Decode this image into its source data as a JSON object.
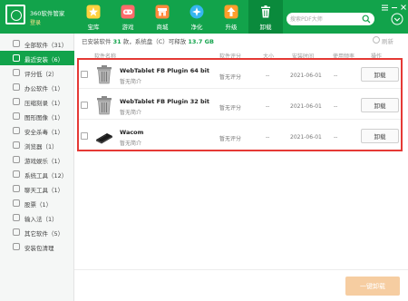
{
  "app": {
    "name": "360软件管家",
    "login": "登录"
  },
  "nav": {
    "tabs": [
      {
        "label": "宝库",
        "icon": "star-icon",
        "active": false
      },
      {
        "label": "游戏",
        "icon": "gamepad-icon",
        "active": false
      },
      {
        "label": "商城",
        "icon": "store-icon",
        "active": false
      },
      {
        "label": "净化",
        "icon": "clean-icon",
        "active": false
      },
      {
        "label": "升级",
        "icon": "upgrade-icon",
        "active": false
      },
      {
        "label": "卸载",
        "icon": "trash-icon",
        "active": true
      }
    ]
  },
  "search": {
    "placeholder": "搜索PDF大师"
  },
  "sidebar": {
    "items": [
      {
        "label": "全部软件（31）",
        "active": false
      },
      {
        "label": "最近安装（6）",
        "active": true
      },
      {
        "label": "评分低（2）",
        "active": false
      },
      {
        "label": "办公软件（1）",
        "active": false
      },
      {
        "label": "压缩刻录（1）",
        "active": false
      },
      {
        "label": "图形图像（1）",
        "active": false
      },
      {
        "label": "安全杀毒（1）",
        "active": false
      },
      {
        "label": "浏览器（1）",
        "active": false
      },
      {
        "label": "游戏娱乐（1）",
        "active": false
      },
      {
        "label": "系统工具（12）",
        "active": false
      },
      {
        "label": "聊天工具（1）",
        "active": false
      },
      {
        "label": "股票（1）",
        "active": false
      },
      {
        "label": "输入法（1）",
        "active": false
      },
      {
        "label": "其它软件（5）",
        "active": false
      },
      {
        "label": "安装包清理",
        "active": false
      }
    ]
  },
  "summary": {
    "prefix": "已安装软件",
    "count": "31",
    "middle": "款，系统盘（C）可释放",
    "size": "13.7 GB"
  },
  "refresh_label": "刷新",
  "columns": {
    "name": "软件名称",
    "rating": "软件评分",
    "size": "大小",
    "date": "安装时间",
    "freq": "使用频率",
    "action": "操作"
  },
  "rows": [
    {
      "name": "WebTablet FB Plugin 64 bit",
      "desc": "暂无简介",
      "rating": "暂无评分",
      "size": "--",
      "date": "2021-06-01",
      "freq": "--",
      "action": "卸载",
      "icon": "trash-bin-icon"
    },
    {
      "name": "WebTablet FB Plugin 32 bit",
      "desc": "暂无简介",
      "rating": "暂无评分",
      "size": "--",
      "date": "2021-06-01",
      "freq": "--",
      "action": "卸载",
      "icon": "trash-bin-icon"
    },
    {
      "name": "Wacom",
      "desc": "暂无简介",
      "rating": "暂无评分",
      "size": "--",
      "date": "2021-06-01",
      "freq": "--",
      "action": "卸载",
      "icon": "tablet-icon"
    }
  ],
  "footer": {
    "onekey_label": "一键卸载"
  },
  "colors": {
    "brand": "#12a34b",
    "highlight": "#e53935",
    "onekey_button": "#f6cda1"
  }
}
